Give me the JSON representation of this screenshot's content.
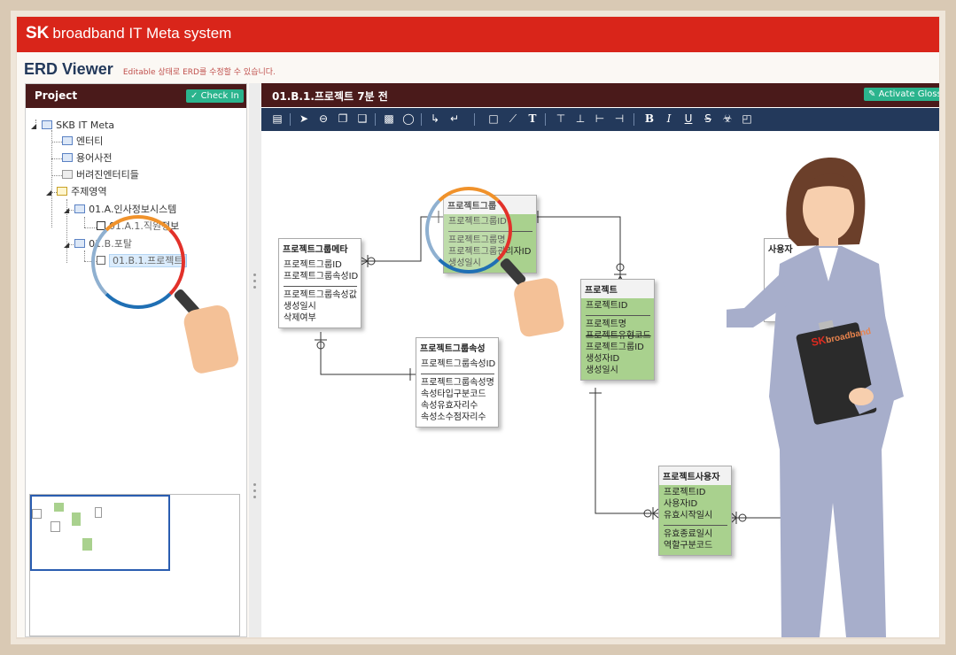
{
  "app": {
    "brand_bold": "SK",
    "brand_rest": "broadband IT Meta system",
    "page_title": "ERD Viewer",
    "page_subtitle": "Editable 상태로 ERD를 수정할 수 있습니다."
  },
  "left": {
    "header": "Project",
    "checkin_label": "Check In",
    "tree": [
      {
        "label": "SKB IT Meta"
      },
      {
        "label": "엔터티"
      },
      {
        "label": "용어사전"
      },
      {
        "label": "버려진엔터티들"
      },
      {
        "label": "주제영역"
      },
      {
        "label": "01.A.인사정보시스템"
      },
      {
        "label": "01.A.1.직원정보"
      },
      {
        "label": "01.B.포탈"
      },
      {
        "label": "01.B.1.프로젝트"
      }
    ]
  },
  "right": {
    "header": "01.B.1.프로젝트  7분 전",
    "glossary_label": "Activate Glossary"
  },
  "entities": {
    "meta": {
      "title": "프로젝트그룹메타",
      "keys": [
        "프로젝트그룹ID",
        "프로젝트그룹속성ID"
      ],
      "attrs": [
        "프로젝트그룹속성값",
        "생성일시",
        "삭제여부"
      ]
    },
    "group": {
      "title": "프로젝트그룹",
      "keys": [
        "프로젝트그룹ID"
      ],
      "attrs": [
        "프로젝트그룹명",
        "프로젝트그룹관리자ID",
        "생성일시"
      ]
    },
    "attr": {
      "title": "프로젝트그룹속성",
      "keys": [
        "프로젝트그룹속성ID"
      ],
      "attrs": [
        "프로젝트그룹속성명",
        "속성타입구분코드",
        "속성유효자리수",
        "속성소수점자리수"
      ]
    },
    "project": {
      "title": "프로젝트",
      "keys": [
        "프로젝트ID"
      ],
      "attrs": [
        "프로젝트명",
        "프로젝트유형코드",
        "프로젝트그룹ID",
        "생성자ID",
        "생성일시"
      ]
    },
    "user": {
      "title": "프로젝트사용자",
      "keys": [
        "프로젝트ID",
        "사용자ID",
        "유효시작일시"
      ],
      "attrs": [
        "유효종료일시",
        "역할구분코드"
      ]
    },
    "partial": {
      "title": "사용자"
    }
  },
  "illustration": {
    "clipboard_bold": "SK",
    "clipboard_rest": "broadband"
  },
  "colors": {
    "brand_red": "#d9251a",
    "header_dark": "#4a1a1a",
    "toolbar_navy": "#23395b",
    "entity_green": "#a9d18e",
    "button_green": "#2bb48d"
  }
}
